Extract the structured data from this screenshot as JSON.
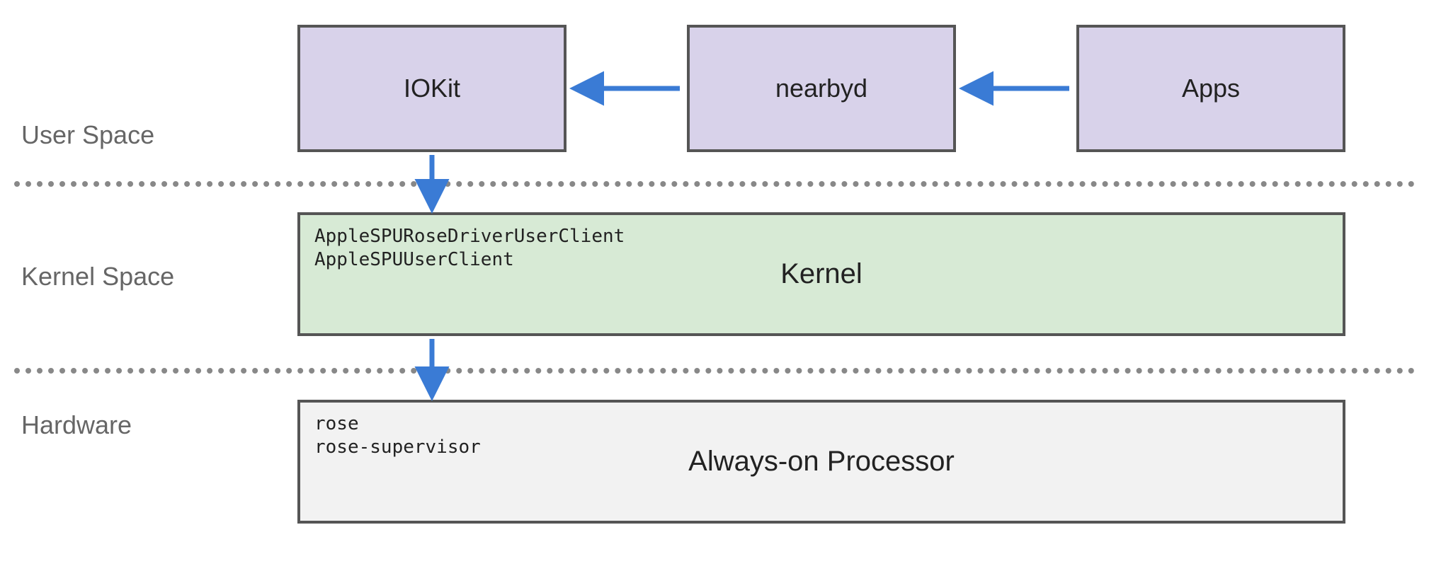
{
  "layers": {
    "user": {
      "label": "User Space"
    },
    "kernel": {
      "label": "Kernel Space"
    },
    "hw": {
      "label": "Hardware"
    }
  },
  "boxes": {
    "iokit": {
      "label": "IOKit"
    },
    "nearbyd": {
      "label": "nearbyd"
    },
    "apps": {
      "label": "Apps"
    },
    "kernel": {
      "title": "Kernel",
      "annot_line1": "AppleSPURoseDriverUserClient",
      "annot_line2": "AppleSPUUserClient"
    },
    "aop": {
      "title": "Always-on Processor",
      "annot_line1": "rose",
      "annot_line2": "rose-supervisor"
    }
  },
  "colors": {
    "arrow": "#3a7bd5",
    "purple": "#d8d2ea",
    "green": "#d7ead5",
    "gray": "#f2f2f2"
  }
}
